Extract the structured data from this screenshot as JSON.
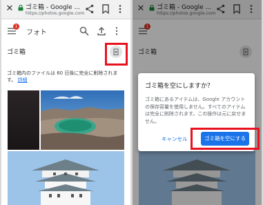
{
  "browser": {
    "title": "ゴミ箱 - Google ...",
    "url": "https://photos.google.com"
  },
  "app": {
    "title": "フォト",
    "notification_count": "1"
  },
  "trash": {
    "title": "ゴミ箱",
    "info_text": "ゴミ箱内のファイルは 60 日後に完全に削除されます。",
    "info_link": "詳細"
  },
  "dialog": {
    "title": "ゴミ箱を空にしますか？",
    "body": "ゴミ箱にあるアイテムは、Google アカウントの保存容量を使用しません。すべてのアイテムは完全に削除されます。この操作は元に戻せません。",
    "cancel_label": "キャンセル",
    "confirm_label": "ゴミ箱を空にする"
  },
  "colors": {
    "accent": "#1a73e8",
    "highlight": "#e8111f",
    "notification": "#d93025"
  }
}
